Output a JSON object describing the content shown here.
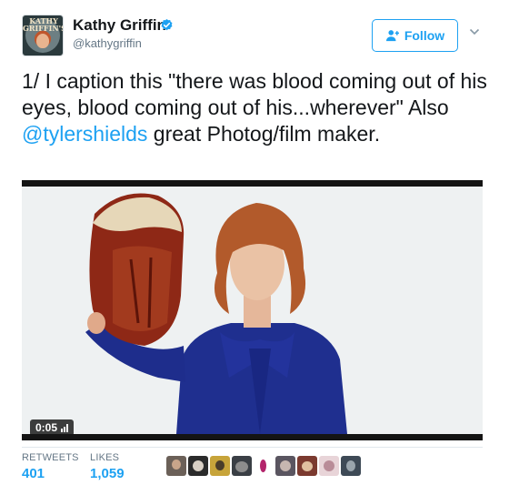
{
  "author": {
    "name": "Kathy Griffin",
    "handle": "@kathygriffin",
    "avatar_text": "KATHY GRIFFIN'S",
    "verified_icon": "verified-badge-icon"
  },
  "follow_button": {
    "label": "Follow",
    "icon": "add-user-icon"
  },
  "menu_icon": "chevron-down-icon",
  "tweet": {
    "text_before": "1/ I caption this \"there was blood coming out of his eyes, blood coming out of his...wherever\" Also ",
    "mention": "@tylershields",
    "text_after": " great Photog/film maker."
  },
  "media": {
    "duration": "0:05"
  },
  "stats": {
    "retweets_label": "RETWEETS",
    "retweets_value": "401",
    "likes_label": "LIKES",
    "likes_value": "1,059"
  },
  "colors": {
    "accent": "#1da1f2",
    "muted": "#657786",
    "text": "#14171a"
  }
}
